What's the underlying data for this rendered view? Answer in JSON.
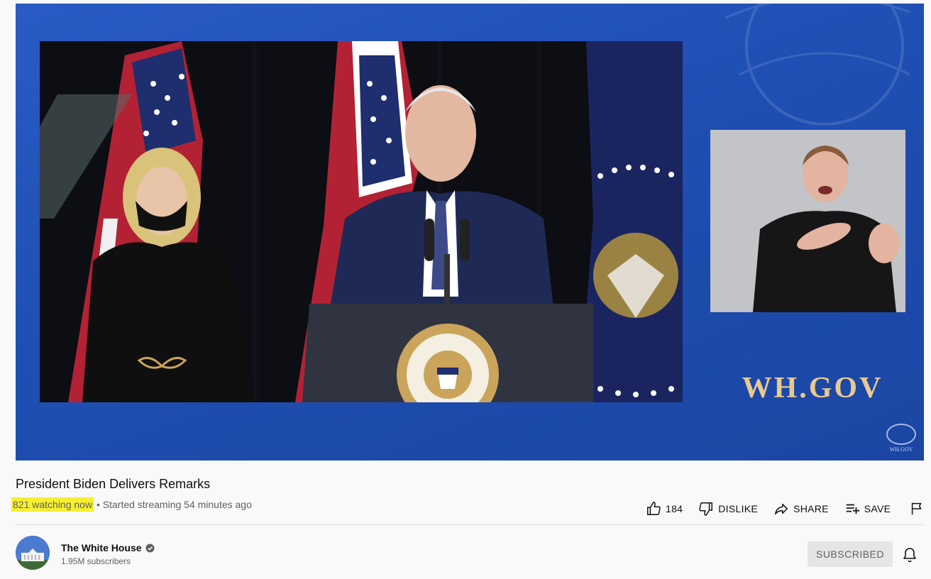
{
  "video": {
    "overlay_text": "WH.GOV",
    "watermark_text": "WH.GOV"
  },
  "title": "President Biden Delivers Remarks",
  "meta": {
    "watching": "821 watching now",
    "separator": " • ",
    "started": "Started streaming 54 minutes ago"
  },
  "actions": {
    "like_count": "184",
    "dislike_label": "DISLIKE",
    "share_label": "SHARE",
    "save_label": "SAVE"
  },
  "channel": {
    "name": "The White House",
    "subscribers": "1.95M subscribers",
    "subscribe_label": "SUBSCRIBED"
  },
  "colors": {
    "highlight": "#f6ef31",
    "player_blue": "#1f4fb3",
    "overlay_gold": "#e8c98f"
  },
  "icons": [
    "like-icon",
    "dislike-icon",
    "share-icon",
    "save-icon",
    "flag-icon",
    "verified-icon",
    "bell-icon"
  ]
}
